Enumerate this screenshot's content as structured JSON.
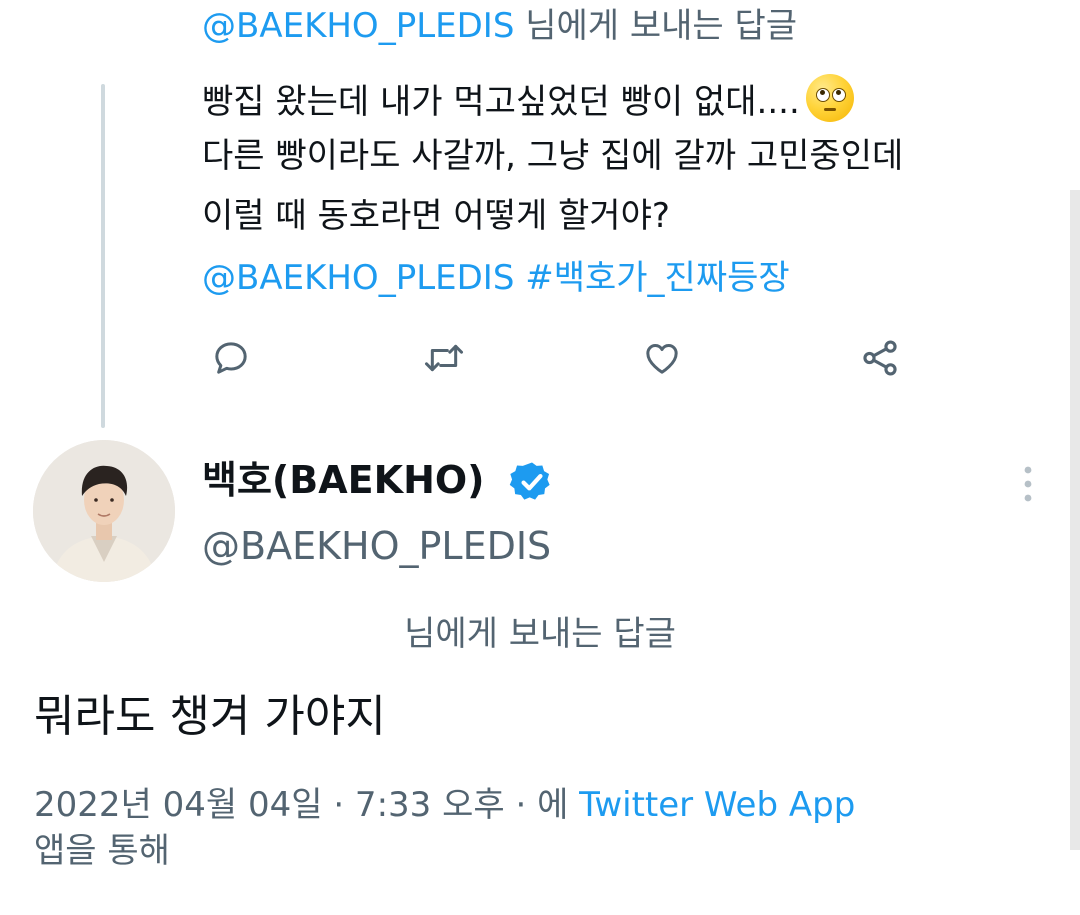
{
  "parent": {
    "reply_prefix_handle": "@BAEKHO_PLEDIS",
    "reply_prefix_suffix": " 님에게 보내는 답글",
    "line1": "빵집 왔는데 내가 먹고싶었던 빵이 없대....",
    "line1_emoji": "pleading-face-emoji",
    "line2": "다른 빵이라도 사갈까, 그냥 집에 갈까 고민중인데",
    "line3": "이럴 때 동호라면 어떻게 할거야?",
    "mention": "@BAEKHO_PLEDIS",
    "hashtag": "#백호가_진짜등장"
  },
  "actions": {
    "reply_icon": "reply-icon",
    "retweet_icon": "retweet-icon",
    "like_icon": "like-icon",
    "share_icon": "share-icon"
  },
  "tweet": {
    "display_name": "백호(BAEKHO)",
    "verified_icon": "verified-badge-icon",
    "handle": "@BAEKHO_PLEDIS",
    "reply_to_label": "님에게 보내는 답글",
    "text": "뭐라도 챙겨 가야지",
    "timestamp": "2022년 04월 04일 · 7:33 오후 · 에 ",
    "source_link": "Twitter Web App",
    "source_suffix": "앱을 통해"
  },
  "colors": {
    "link": "#1d9bf0",
    "text": "#0f1419",
    "muted": "#536471",
    "thread_line": "#cfd9de"
  }
}
